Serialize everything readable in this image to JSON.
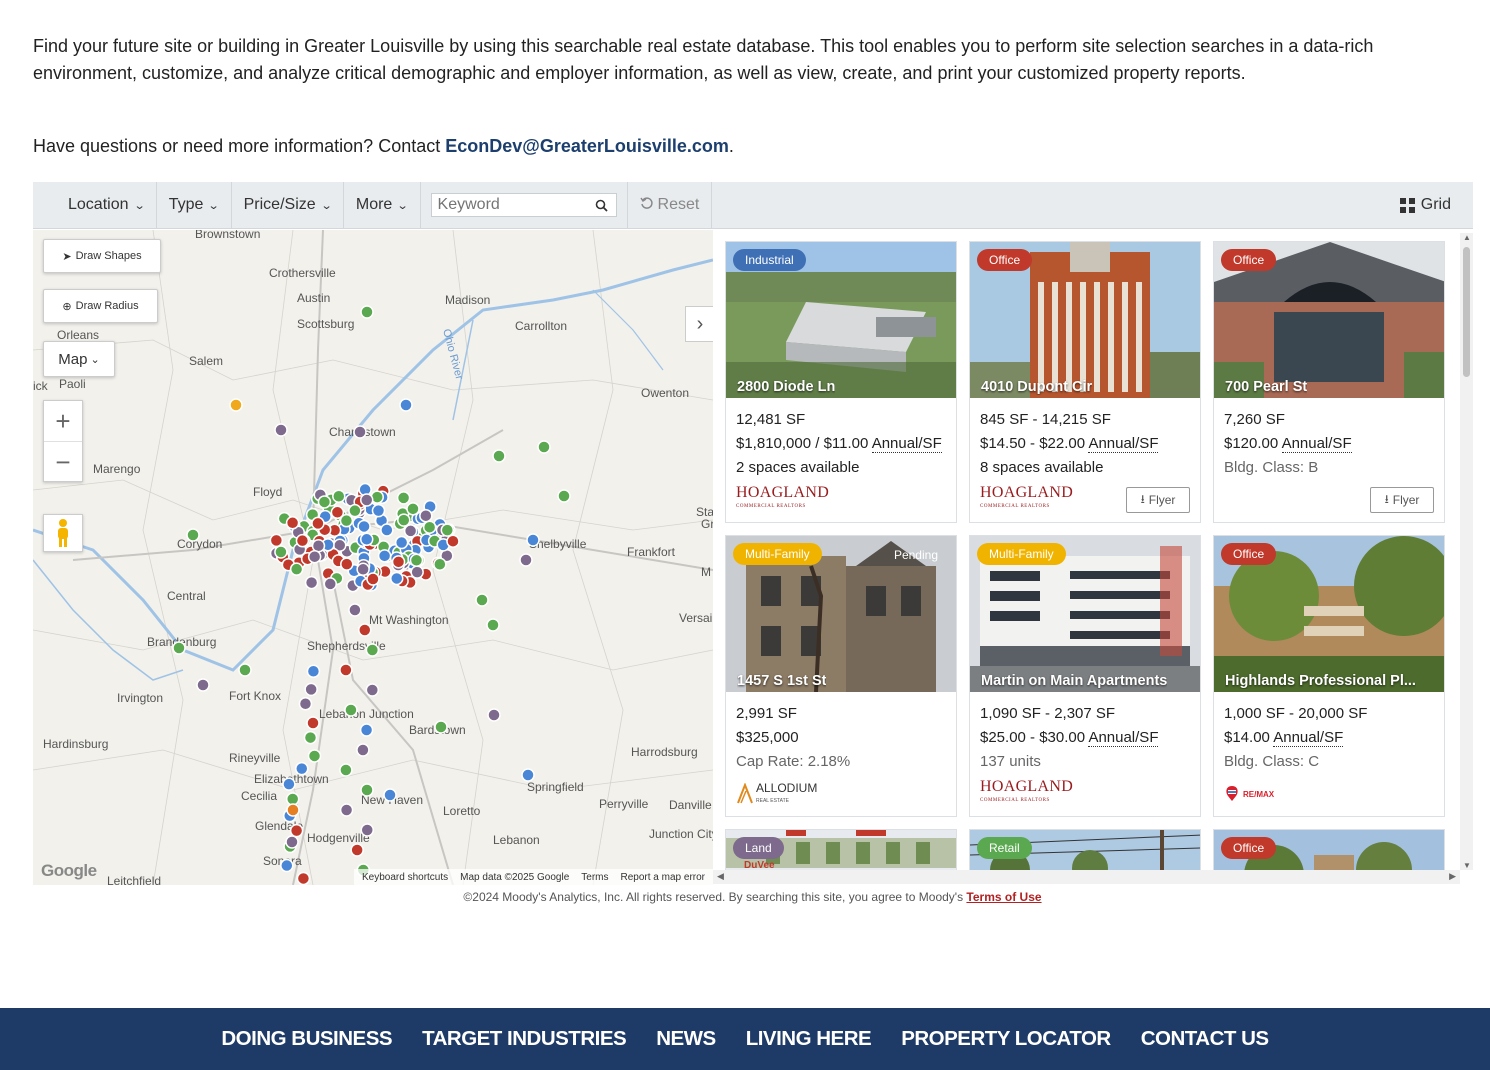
{
  "intro": {
    "paragraph": "Find your future site or building in Greater Louisville by using this searchable real estate database. This tool enables you to perform site selection searches in a data-rich environment, customize, and analyze critical demographic and employer information, as well as view, create, and print your customized property reports.",
    "contact_prefix": "Have questions or need more information? Contact ",
    "contact_email": "EconDev@GreaterLouisville.com",
    "contact_suffix": "."
  },
  "toolbar": {
    "location": "Location",
    "type": "Type",
    "price_size": "Price/Size",
    "more": "More",
    "keyword_placeholder": "Keyword",
    "reset": "Reset",
    "view_mode": "Grid"
  },
  "map": {
    "draw_shapes": "Draw Shapes",
    "draw_radius": "Draw Radius",
    "map_type": "Map",
    "zoom_in": "+",
    "zoom_out": "−",
    "google": "Google",
    "attribution": {
      "shortcuts": "Keyboard shortcuts",
      "data": "Map data ©2025 Google",
      "terms": "Terms",
      "report": "Report a map error"
    },
    "places": [
      "Brownstown",
      "Crothersville",
      "Austin",
      "Scottsburg",
      "Madison",
      "Carrollton",
      "Orleans",
      "Salem",
      "Paoli",
      "Owenton",
      "Charlestown",
      "Marengo",
      "Floyd",
      "Corydon",
      "Frankfort",
      "Central",
      "Brandenburg",
      "Shepherdsville",
      "Mt Washington",
      "Versailles",
      "Irvington",
      "Fort Knox",
      "Lebanon Junction",
      "Bardstown",
      "Hardinsburg",
      "Radcliff",
      "Rineyville",
      "Elizabethtown",
      "Harrodsburg",
      "Cecilia",
      "New Haven",
      "Springfield",
      "Perryville",
      "Danville",
      "Glendale",
      "Loretto",
      "Hodgenville",
      "Lebanon",
      "Junction City",
      "Sonora",
      "Leitchfield",
      "Ohio River",
      "Lo",
      "Shelbyville",
      "Sta",
      "Gr",
      "ick",
      "M"
    ]
  },
  "listings": [
    {
      "tag": "Industrial",
      "tag_color": "#3f6fb5",
      "address": "2800 Diode Ln",
      "line1": "12,481 SF",
      "line2a": "$1,810,000 / $11.00 ",
      "line2b": "Annual/SF",
      "line3": "2 spaces available",
      "broker": "HOAGLAND",
      "broker_sub": "COMMERCIAL REALTORS",
      "flyer": ""
    },
    {
      "tag": "Office",
      "tag_color": "#c0392b",
      "address": "4010 Dupont Cir",
      "line1": "845 SF - 14,215 SF",
      "line2a": "$14.50 - $22.00 ",
      "line2b": "Annual/SF",
      "line3": "8 spaces available",
      "broker": "HOAGLAND",
      "broker_sub": "COMMERCIAL REALTORS",
      "flyer": "Flyer"
    },
    {
      "tag": "Office",
      "tag_color": "#c0392b",
      "address": "700 Pearl St",
      "line1": "7,260 SF",
      "line2a": "$120.00 ",
      "line2b": "Annual/SF",
      "line3": "Bldg. Class: B",
      "broker": "",
      "broker_sub": "",
      "flyer": "Flyer"
    },
    {
      "tag": "Multi-Family",
      "tag_color": "#f0b400",
      "address": "1457 S 1st St",
      "line1": "2,991 SF",
      "line2a": "$325,000",
      "line2b": "",
      "line3": "Cap Rate: 2.18%",
      "broker": "ALLODIUM",
      "broker_sub": "REAL ESTATE",
      "flyer": ""
    },
    {
      "tag": "Multi-Family",
      "tag_color": "#f0b400",
      "address": "Martin on Main Apartments",
      "line1": "1,090 SF - 2,307 SF",
      "line2a": "$25.00 - $30.00 ",
      "line2b": "Annual/SF",
      "line3": "137 units",
      "broker": "HOAGLAND",
      "broker_sub": "COMMERCIAL REALTORS",
      "flyer": ""
    },
    {
      "tag": "Office",
      "tag_color": "#c0392b",
      "address": "Highlands Professional Pl...",
      "line1": "1,000 SF - 20,000 SF",
      "line2a": "$14.00 ",
      "line2b": "Annual/SF",
      "line3": "Bldg. Class: C",
      "broker": "RE/MAX",
      "broker_sub": "",
      "flyer": ""
    },
    {
      "tag": "Land",
      "tag_color": "#7d6a8c",
      "address": "",
      "line1": "",
      "line2a": "",
      "line2b": "",
      "line3": "",
      "broker": "",
      "broker_sub": "",
      "flyer": ""
    },
    {
      "tag": "Retail",
      "tag_color": "#5aa84f",
      "address": "",
      "line1": "",
      "line2a": "",
      "line2b": "",
      "line3": "",
      "broker": "",
      "broker_sub": "",
      "flyer": ""
    },
    {
      "tag": "Office",
      "tag_color": "#c0392b",
      "address": "",
      "line1": "",
      "line2a": "",
      "line2b": "",
      "line3": "",
      "broker": "",
      "broker_sub": "",
      "flyer": ""
    }
  ],
  "photo_overlay": {
    "pending": "Pending",
    "duvee": "DuVee"
  },
  "copyright": {
    "text": "©2024 Moody's Analytics, Inc. All rights reserved. By searching this site, you agree to Moody's ",
    "link": "Terms of Use"
  },
  "footer": {
    "items": [
      "DOING BUSINESS",
      "TARGET INDUSTRIES",
      "NEWS",
      "LIVING HERE",
      "PROPERTY LOCATOR",
      "CONTACT US"
    ]
  },
  "colors": {
    "brand_navy": "#1e3a66",
    "link_navy": "#1c3f6e",
    "terms_red": "#b22222"
  }
}
